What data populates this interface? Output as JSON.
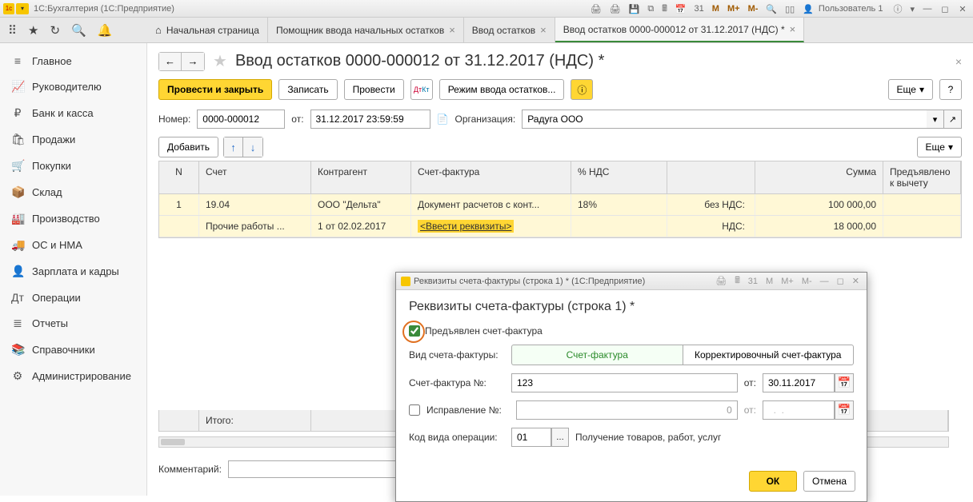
{
  "titlebar": {
    "app_title": "1С:Бухгалтерия  (1С:Предприятие)",
    "user_label": "Пользователь 1"
  },
  "toolbar_icons": {
    "apps": "⦿",
    "star": "★",
    "history": "↺",
    "search": "🔍",
    "bell": "△"
  },
  "tabs": [
    {
      "label": "Начальная страница",
      "has_home": true,
      "closable": false
    },
    {
      "label": "Помощник ввода начальных остатков",
      "closable": true
    },
    {
      "label": "Ввод остатков",
      "closable": true
    },
    {
      "label": "Ввод остатков 0000-000012 от 31.12.2017 (НДС) *",
      "closable": true,
      "active": true
    }
  ],
  "sidebar": [
    {
      "icon": "≡",
      "label": "Главное"
    },
    {
      "icon": "📈",
      "label": "Руководителю"
    },
    {
      "icon": "₽",
      "label": "Банк и касса"
    },
    {
      "icon": "🛍",
      "label": "Продажи"
    },
    {
      "icon": "🛒",
      "label": "Покупки"
    },
    {
      "icon": "📦",
      "label": "Склад"
    },
    {
      "icon": "🏭",
      "label": "Производство"
    },
    {
      "icon": "🚚",
      "label": "ОС и НМА"
    },
    {
      "icon": "👤",
      "label": "Зарплата и кадры"
    },
    {
      "icon": "Дт",
      "label": "Операции"
    },
    {
      "icon": "≣",
      "label": "Отчеты"
    },
    {
      "icon": "📚",
      "label": "Справочники"
    },
    {
      "icon": "⚙",
      "label": "Администрирование"
    }
  ],
  "document": {
    "title": "Ввод остатков 0000-000012 от 31.12.2017 (НДС) *",
    "buttons": {
      "post_close": "Провести и закрыть",
      "save": "Записать",
      "post": "Провести",
      "mode": "Режим ввода остатков...",
      "more": "Еще",
      "help": "?",
      "add": "Добавить"
    },
    "fields": {
      "number_label": "Номер:",
      "number": "0000-000012",
      "from_label": "от:",
      "from": "31.12.2017 23:59:59",
      "org_label": "Организация:",
      "org": "Радуга ООО"
    },
    "table": {
      "headers": {
        "n": "N",
        "acc": "Счет",
        "contr": "Контрагент",
        "sf": "Счет-фактура",
        "vat": "% НДС",
        "sum": "Сумма",
        "ded": "Предъявлено к вычету"
      },
      "row1": {
        "n": "1",
        "acc": "19.04",
        "contr": "ООО \"Дельта\"",
        "sf": "Документ расчетов с конт...",
        "vat": "18%",
        "novat_label": "без НДС:",
        "sum": "100 000,00"
      },
      "row2": {
        "acc": "Прочие работы ...",
        "contr": "1 от 02.02.2017",
        "sf": "<Ввести реквизиты>",
        "novat_label": "НДС:",
        "sum": "18 000,00"
      },
      "total_label": "Итого:"
    },
    "comment_label": "Комментарий:",
    "comment": ""
  },
  "popup": {
    "window_title": "Реквизиты счета-фактуры (строка 1) *  (1С:Предприятие)",
    "heading": "Реквизиты счета-фактуры (строка 1) *",
    "presented_label": "Предъявлен счет-фактура",
    "type_label": "Вид счета-фактуры:",
    "type_options": {
      "invoice": "Счет-фактура",
      "corr": "Корректировочный счет-фактура"
    },
    "sf_no_label": "Счет-фактура №:",
    "sf_no": "123",
    "sf_from_label": "от:",
    "sf_date": "30.11.2017",
    "corr_no_label": "Исправление №:",
    "corr_no": "0",
    "corr_from_label": "от:",
    "corr_date": "  .  .    ",
    "opcode_label": "Код вида операции:",
    "opcode": "01",
    "opcode_desc": "Получение товаров, работ, услуг",
    "ok": "ОК",
    "cancel": "Отмена"
  }
}
